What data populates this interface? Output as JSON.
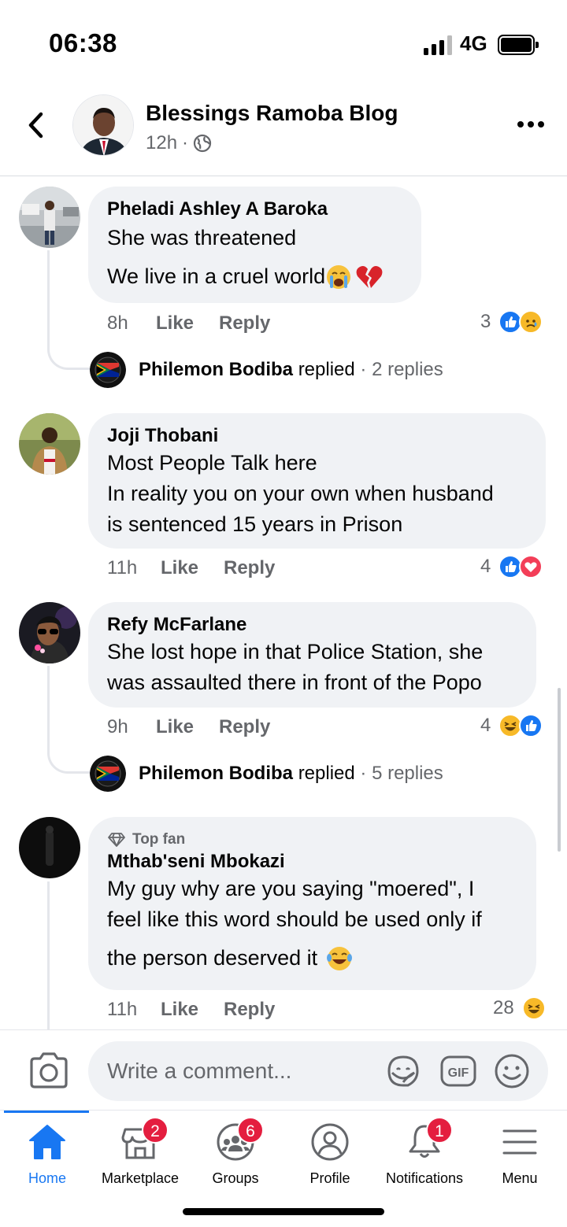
{
  "status": {
    "time": "06:38",
    "network": "4G"
  },
  "post": {
    "page_name": "Blessings Ramoba Blog",
    "age": "12h",
    "separator": "·"
  },
  "comments": [
    {
      "author": "Pheladi Ashley A Baroka",
      "lines": [
        "She was threatened",
        "We live in a cruel world"
      ],
      "time": "8h",
      "like": "Like",
      "reply": "Reply",
      "reaction_count": "3",
      "reactions": [
        "like",
        "sad"
      ],
      "replied": {
        "name": "Philemon Bodiba",
        "verb": "replied",
        "count": "· 2 replies"
      }
    },
    {
      "author": "Joji Thobani",
      "lines": [
        "Most People Talk here",
        "In reality you on your own when husband",
        "is sentenced 15 years in Prison"
      ],
      "time": "11h",
      "like": "Like",
      "reply": "Reply",
      "reaction_count": "4",
      "reactions": [
        "like",
        "love"
      ]
    },
    {
      "author": "Refy McFarlane",
      "lines": [
        "She lost hope in that Police Station, she",
        "was assaulted there in front of the Popo"
      ],
      "time": "9h",
      "like": "Like",
      "reply": "Reply",
      "reaction_count": "4",
      "reactions": [
        "haha",
        "like"
      ],
      "replied": {
        "name": "Philemon Bodiba",
        "verb": "replied",
        "count": "· 5 replies"
      }
    },
    {
      "badge": "Top fan",
      "author": "Mthab'seni Mbokazi",
      "lines": [
        "My guy why are you saying \"moered\", I",
        "feel like this word should be used only if",
        "the person deserved it"
      ],
      "time": "11h",
      "like": "Like",
      "reply": "Reply",
      "reaction_count": "28",
      "reactions": [
        "haha"
      ]
    }
  ],
  "composer": {
    "placeholder": "Write a comment..."
  },
  "tabs": [
    {
      "label": "Home",
      "active": true
    },
    {
      "label": "Marketplace",
      "badge": "2"
    },
    {
      "label": "Groups",
      "badge": "6"
    },
    {
      "label": "Profile"
    },
    {
      "label": "Notifications",
      "badge": "1"
    },
    {
      "label": "Menu"
    }
  ],
  "colors": {
    "accent": "#1877f2",
    "badge": "#e41e3f",
    "bubble": "#f0f2f5",
    "secondary_text": "#65676b"
  }
}
